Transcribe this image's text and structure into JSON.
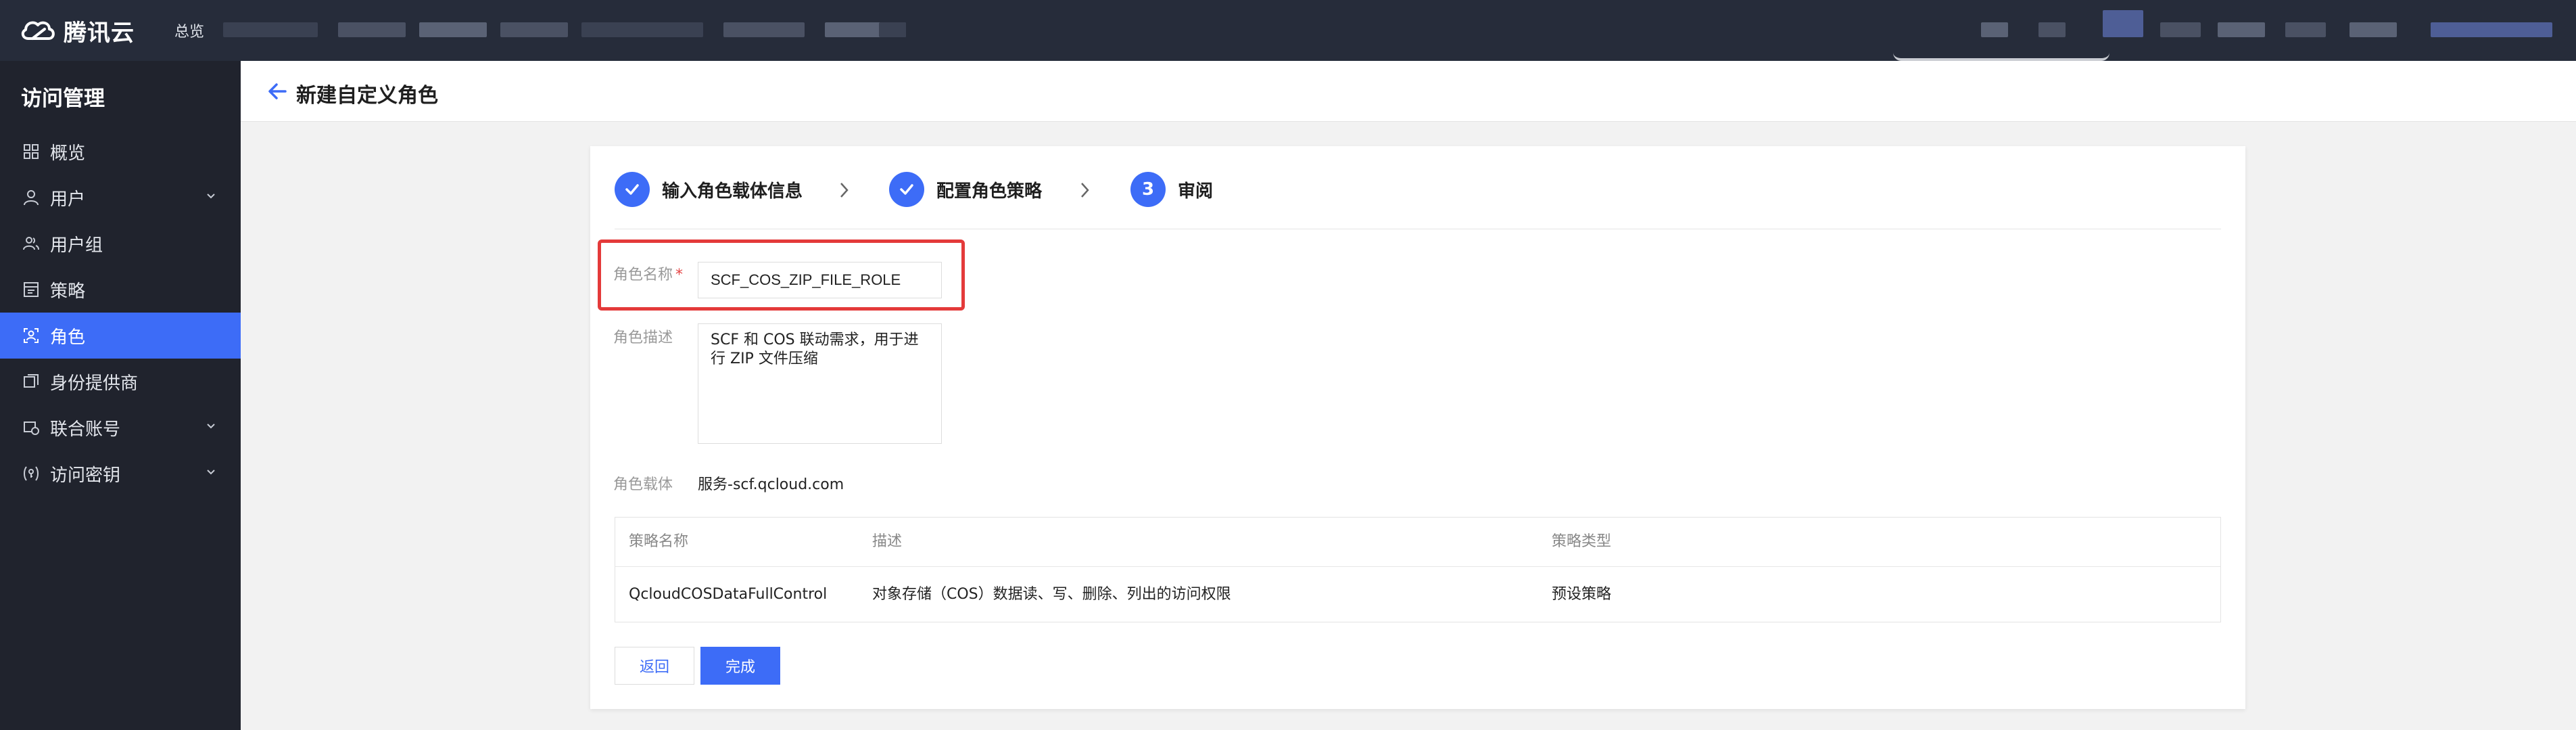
{
  "topnav": {
    "brand": "腾讯云",
    "overview_label": "总览"
  },
  "sidebar": {
    "title": "访问管理",
    "items": [
      {
        "label": "概览",
        "icon": "dashboard-icon",
        "expandable": false,
        "active": false
      },
      {
        "label": "用户",
        "icon": "user-icon",
        "expandable": true,
        "active": false
      },
      {
        "label": "用户组",
        "icon": "user-group-icon",
        "expandable": false,
        "active": false
      },
      {
        "label": "策略",
        "icon": "policy-icon",
        "expandable": false,
        "active": false
      },
      {
        "label": "角色",
        "icon": "role-icon",
        "expandable": false,
        "active": true
      },
      {
        "label": "身份提供商",
        "icon": "identity-provider-icon",
        "expandable": false,
        "active": false
      },
      {
        "label": "联合账号",
        "icon": "federated-account-icon",
        "expandable": true,
        "active": false
      },
      {
        "label": "访问密钥",
        "icon": "access-key-icon",
        "expandable": true,
        "active": false
      }
    ]
  },
  "header": {
    "title": "新建自定义角色"
  },
  "steps": [
    {
      "label": "输入角色载体信息",
      "state": "done"
    },
    {
      "label": "配置角色策略",
      "state": "done"
    },
    {
      "label": "审阅",
      "state": "current",
      "number": "3"
    }
  ],
  "form": {
    "role_name_label": "角色名称",
    "required_mark": "*",
    "role_name_value": "SCF_COS_ZIP_FILE_ROLE",
    "role_desc_label": "角色描述",
    "role_desc_value": "SCF 和 COS 联动需求，用于进\n行 ZIP 文件压缩",
    "role_carrier_label": "角色载体",
    "role_carrier_value": "服务-scf.qcloud.com"
  },
  "policy_table": {
    "columns": [
      "策略名称",
      "描述",
      "策略类型"
    ],
    "rows": [
      {
        "name": "QcloudCOSDataFullControl",
        "desc": "对象存储（COS）数据读、写、删除、列出的访问权限",
        "type": "预设策略"
      }
    ]
  },
  "actions": {
    "back_label": "返回",
    "done_label": "完成"
  },
  "colors": {
    "accent": "#3d6cf7",
    "nav_bg": "#262c3a",
    "sidebar_bg": "#20232d",
    "highlight_frame": "#e43a3a"
  }
}
